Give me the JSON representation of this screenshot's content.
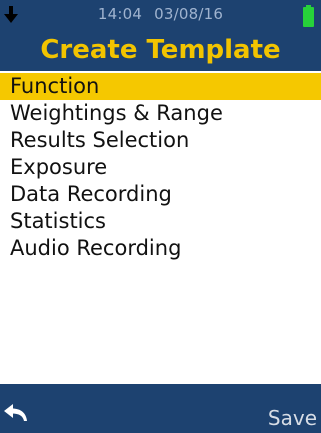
{
  "status": {
    "time": "14:04",
    "date": "03/08/16",
    "arrow_icon": "download-arrow-icon",
    "battery_icon": "battery-icon",
    "battery_color": "#27d23a"
  },
  "header": {
    "title": "Create Template"
  },
  "menu": {
    "items": [
      {
        "label": "Function",
        "selected": true
      },
      {
        "label": "Weightings & Range",
        "selected": false
      },
      {
        "label": "Results Selection",
        "selected": false
      },
      {
        "label": "Exposure",
        "selected": false
      },
      {
        "label": "Data Recording",
        "selected": false
      },
      {
        "label": "Statistics",
        "selected": false
      },
      {
        "label": "Audio Recording",
        "selected": false
      }
    ]
  },
  "footer": {
    "back_icon": "back-arrow-icon",
    "save_label": "Save"
  },
  "colors": {
    "bar_background": "#1d4270",
    "title": "#f2c400",
    "selection": "#f5c800"
  }
}
